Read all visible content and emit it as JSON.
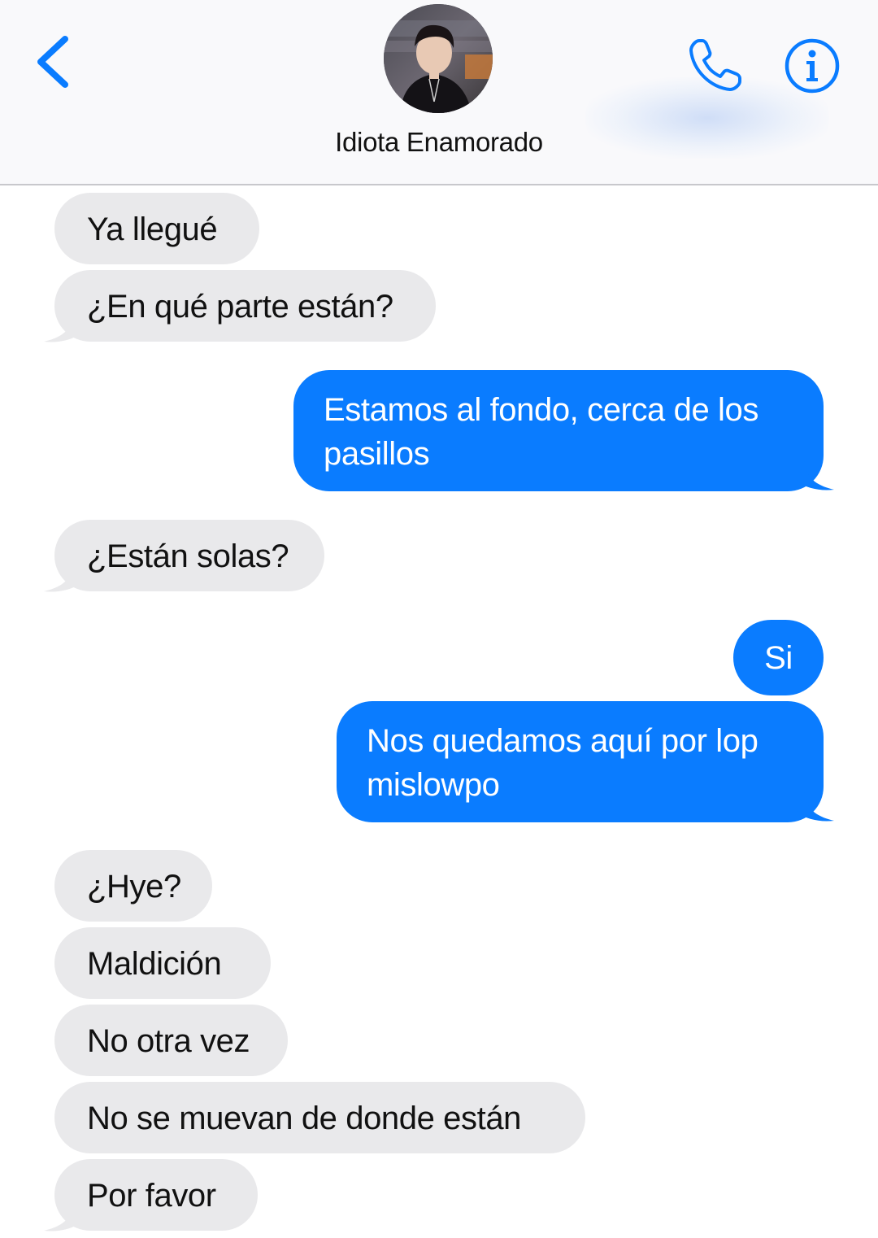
{
  "header": {
    "contact_name": "Idiota Enamorado",
    "back_icon": "chevron-left-icon",
    "call_icon": "phone-icon",
    "info_icon": "info-icon"
  },
  "colors": {
    "sent_bubble": "#0a7cff",
    "received_bubble": "#e9e9eb",
    "accent": "#0a7cff"
  },
  "messages": [
    {
      "direction": "received",
      "text": "Ya llegué"
    },
    {
      "direction": "received",
      "text": "¿En qué parte están?"
    },
    {
      "direction": "sent",
      "text": "Estamos al fondo, cerca de los pasillos"
    },
    {
      "direction": "received",
      "text": "¿Están solas?"
    },
    {
      "direction": "sent",
      "text": "Si"
    },
    {
      "direction": "sent",
      "text": "Nos quedamos aquí por lop mislowpo"
    },
    {
      "direction": "received",
      "text": "¿Hye?"
    },
    {
      "direction": "received",
      "text": "Maldición"
    },
    {
      "direction": "received",
      "text": "No otra vez"
    },
    {
      "direction": "received",
      "text": "No se muevan de donde están"
    },
    {
      "direction": "received",
      "text": "Por favor"
    }
  ]
}
